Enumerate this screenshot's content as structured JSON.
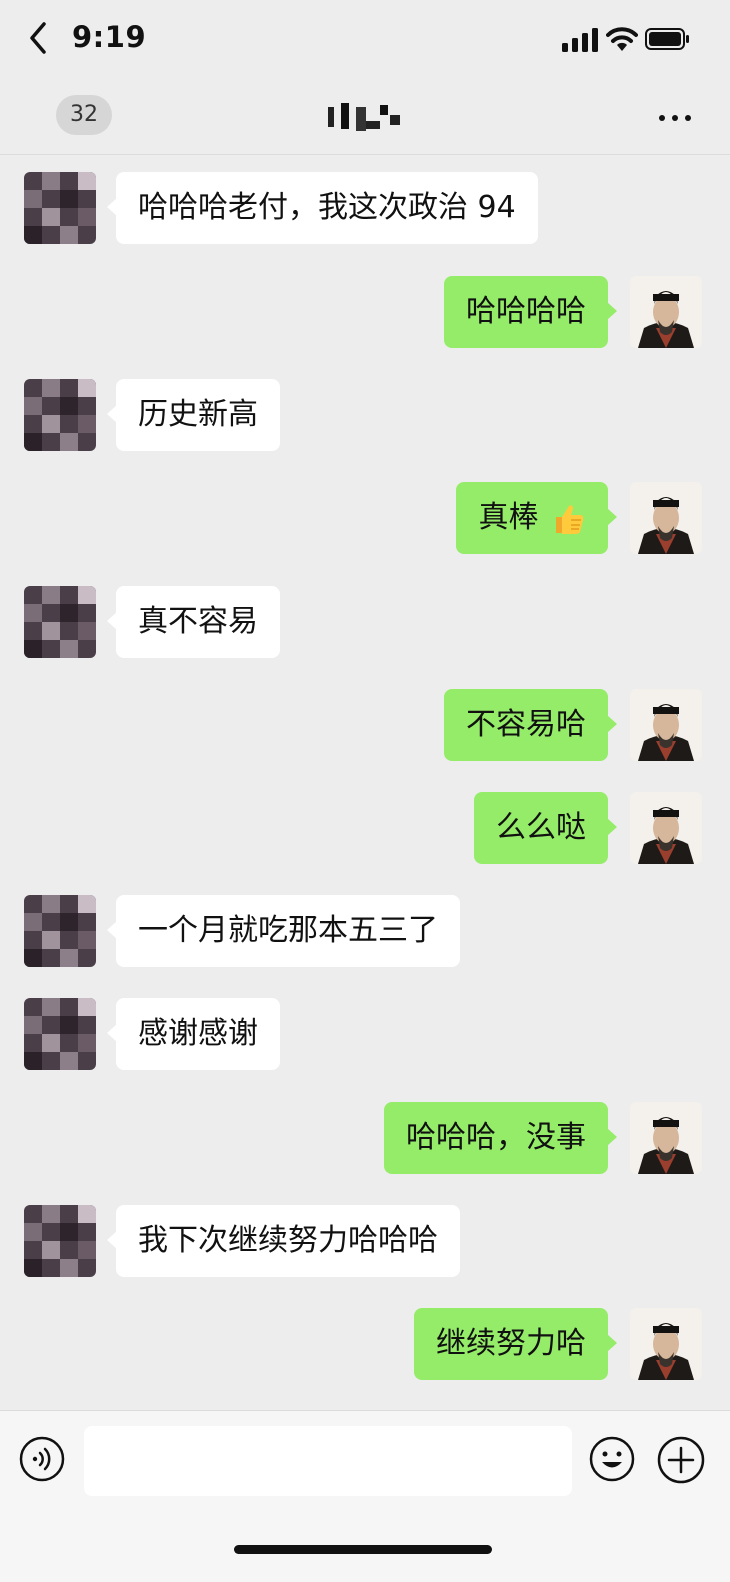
{
  "status_bar": {
    "time": "9:19"
  },
  "header": {
    "back_label": "<",
    "unread_count": "32",
    "more_label": "..."
  },
  "messages": [
    {
      "side": "left",
      "text": "哈哈哈老付，我这次政治 94"
    },
    {
      "side": "right",
      "text": "哈哈哈哈"
    },
    {
      "side": "left",
      "text": "历史新高"
    },
    {
      "side": "right",
      "text": "真棒",
      "emoji": "thumbs-up"
    },
    {
      "side": "left",
      "text": "真不容易"
    },
    {
      "side": "right",
      "text": "不容易哈"
    },
    {
      "side": "right",
      "text": "么么哒"
    },
    {
      "side": "left",
      "text": "一个月就吃那本五三了"
    },
    {
      "side": "left",
      "text": "感谢感谢"
    },
    {
      "side": "right",
      "text": "哈哈哈，没事"
    },
    {
      "side": "left",
      "text": "我下次继续努力哈哈哈"
    },
    {
      "side": "right",
      "text": "继续努力哈"
    }
  ],
  "input": {
    "value": ""
  },
  "icons": {
    "back": "chevron-left-icon",
    "more": "more-dots-icon",
    "voice": "voice-icon",
    "emoji": "emoji-icon",
    "plus": "plus-icon",
    "signal": "signal-icon",
    "wifi": "wifi-icon",
    "battery": "battery-icon"
  },
  "colors": {
    "background": "#ededed",
    "outgoing_bubble": "#95ec69",
    "incoming_bubble": "#ffffff"
  }
}
